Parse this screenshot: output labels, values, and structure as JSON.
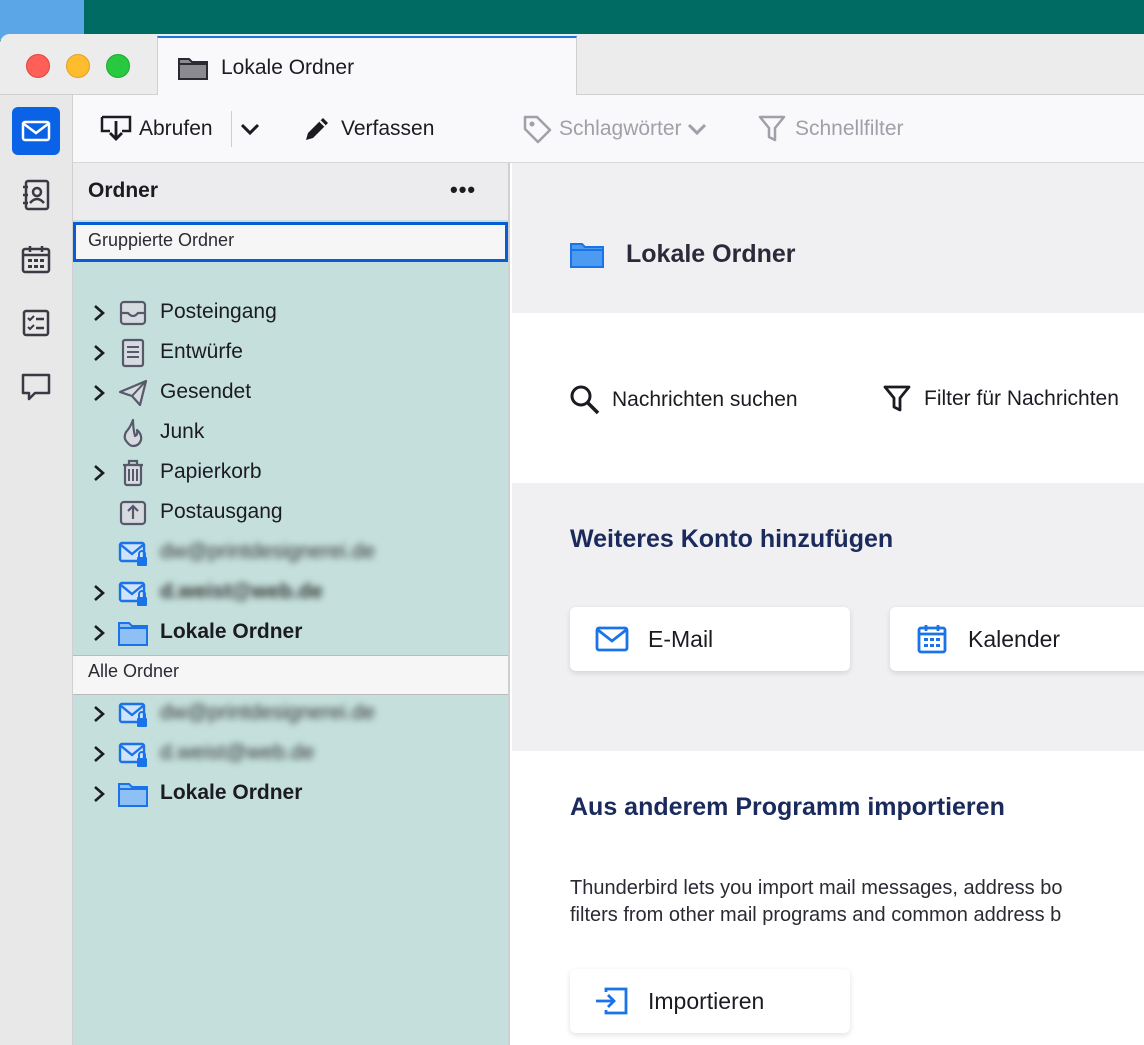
{
  "window": {
    "tab_title": "Lokale Ordner"
  },
  "toolbar": {
    "get_messages": "Abrufen",
    "compose": "Verfassen",
    "tags": "Schlagwörter",
    "quick_filter": "Schnellfilter"
  },
  "folder_pane": {
    "title": "Ordner",
    "more": "•••",
    "grouped_header": "Gruppierte Ordner",
    "grouped": [
      {
        "label": "Posteingang",
        "icon": "inbox-icon",
        "expandable": true,
        "bold": false,
        "blurred": false
      },
      {
        "label": "Entwürfe",
        "icon": "drafts-icon",
        "expandable": true,
        "bold": false,
        "blurred": false
      },
      {
        "label": "Gesendet",
        "icon": "sent-icon",
        "expandable": true,
        "bold": false,
        "blurred": false
      },
      {
        "label": "Junk",
        "icon": "junk-icon",
        "expandable": false,
        "bold": false,
        "blurred": false
      },
      {
        "label": "Papierkorb",
        "icon": "trash-icon",
        "expandable": true,
        "bold": false,
        "blurred": false
      },
      {
        "label": "Postausgang",
        "icon": "outbox-icon",
        "expandable": false,
        "bold": false,
        "blurred": false
      },
      {
        "label": "dw@printdesignerei.de",
        "icon": "mail-account-icon",
        "expandable": false,
        "bold": false,
        "blurred": true
      },
      {
        "label": "d.weist@web.de",
        "icon": "mail-account-icon",
        "expandable": true,
        "bold": true,
        "blurred": true
      },
      {
        "label": "Lokale Ordner",
        "icon": "folder-icon",
        "expandable": true,
        "bold": true,
        "blurred": false
      }
    ],
    "all_header": "Alle Ordner",
    "all": [
      {
        "label": "dw@printdesignerei.de",
        "icon": "mail-account-icon",
        "expandable": true,
        "bold": false,
        "blurred": true
      },
      {
        "label": "d.weist@web.de",
        "icon": "mail-account-icon",
        "expandable": true,
        "bold": false,
        "blurred": true
      },
      {
        "label": "Lokale Ordner",
        "icon": "folder-icon",
        "expandable": true,
        "bold": true,
        "blurred": false
      }
    ]
  },
  "main": {
    "title": "Lokale Ordner",
    "search_messages": "Nachrichten suchen",
    "filter_messages": "Filter für Nachrichten",
    "add_account_title": "Weiteres Konto hinzufügen",
    "email_card": "E-Mail",
    "calendar_card": "Kalender",
    "import_title": "Aus anderem Programm importieren",
    "import_text_1": "Thunderbird lets you import mail messages, address bo",
    "import_text_2": "filters from other mail programs and common address b",
    "import_button": "Importieren"
  },
  "colors": {
    "accent": "#0a62e6",
    "folder_pane_bg": "#c5e0dc",
    "section_title": "#1a2a5c"
  }
}
